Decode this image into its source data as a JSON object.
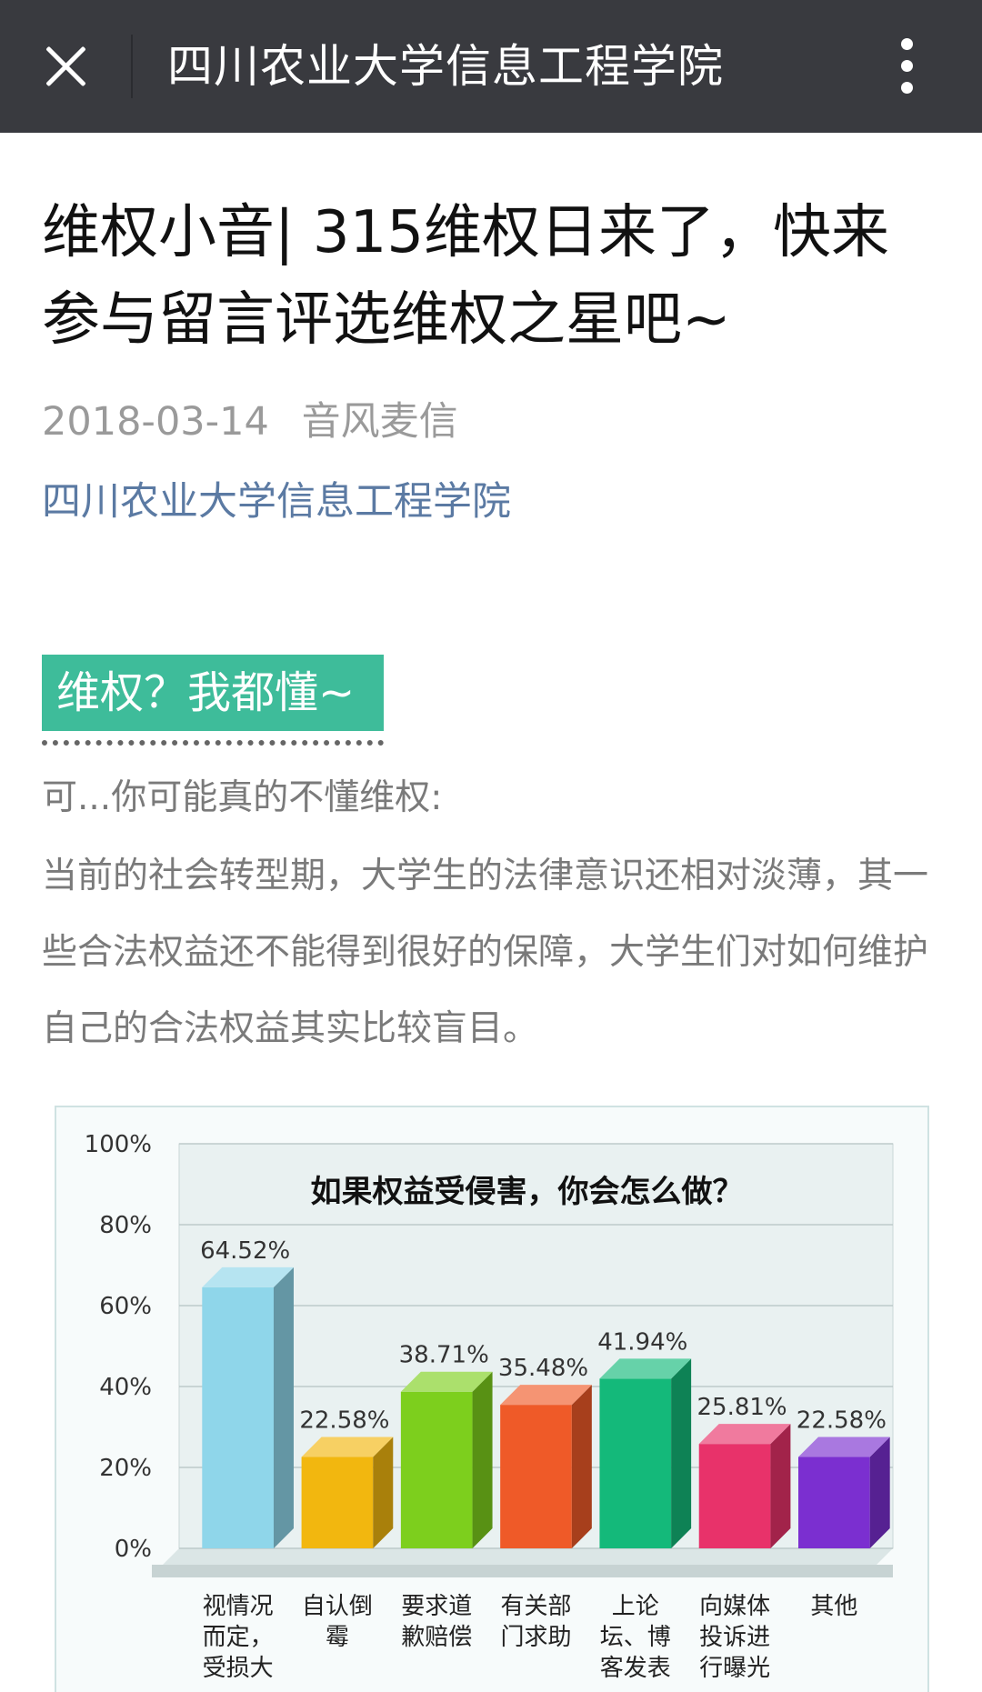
{
  "topbar": {
    "title": "四川农业大学信息工程学院",
    "close_icon": "close-icon",
    "more_icon": "more-vertical-icon"
  },
  "article": {
    "title": "维权小音| 315维权日来了，快来参与留言评选维权之星吧~",
    "date": "2018-03-14",
    "author": "音风麦信",
    "account": "四川农业大学信息工程学院",
    "section_tag": "维权？我都懂~",
    "para_1": "可...你可能真的不懂维权:",
    "para_2": "当前的社会转型期，大学生的法律意识还相对淡薄，其一些合法权益还不能得到很好的保障，大学生们对如何维护自己的合法权益其实比较盲目。"
  },
  "colors": {
    "topbar_bg": "#393a3f",
    "section_tag_bg": "#3ebc9a",
    "link": "#5b7aa3"
  },
  "chart_data": {
    "type": "bar",
    "title": "如果权益受侵害，你会怎么做？",
    "y_ticks": [
      "100%",
      "80%",
      "60%",
      "40%",
      "20%",
      "0%"
    ],
    "ylim": [
      0,
      100
    ],
    "categories": [
      [
        "视情况",
        "而定，",
        "受损大"
      ],
      [
        "自认倒",
        "霉"
      ],
      [
        "要求道",
        "歉赔偿"
      ],
      [
        "有关部",
        "门求助"
      ],
      [
        "上论",
        "坛、博",
        "客发表"
      ],
      [
        "向媒体",
        "投诉进",
        "行曝光"
      ],
      [
        "其他"
      ]
    ],
    "values": [
      64.52,
      22.58,
      38.71,
      35.48,
      41.94,
      25.81,
      22.58
    ],
    "value_labels": [
      "64.52%",
      "22.58%",
      "38.71%",
      "35.48%",
      "41.94%",
      "25.81%",
      "22.58%"
    ],
    "bar_colors": [
      "#8fd6ea",
      "#f2b70f",
      "#7dcf1d",
      "#ef5a28",
      "#14b97a",
      "#e8326a",
      "#7b2fd0"
    ],
    "grid": true
  }
}
